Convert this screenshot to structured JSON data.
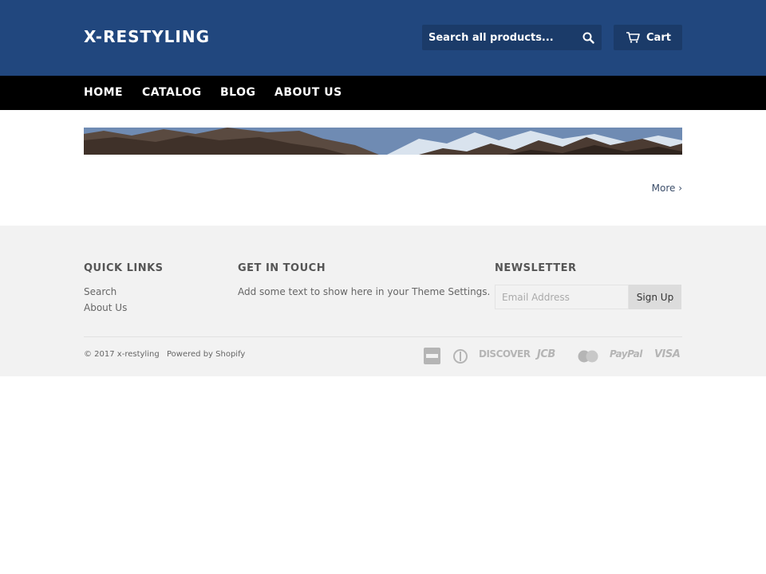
{
  "header": {
    "logo": "X-RESTYLING",
    "search": {
      "placeholder": "Search all products..."
    },
    "cart_label": "Cart"
  },
  "nav": {
    "items": [
      {
        "label": "HOME"
      },
      {
        "label": "CATALOG"
      },
      {
        "label": "BLOG"
      },
      {
        "label": "ABOUT US"
      }
    ]
  },
  "main": {
    "more_link": "More ›"
  },
  "footer": {
    "quick_links": {
      "heading": "QUICK LINKS",
      "items": [
        "Search",
        "About Us"
      ]
    },
    "get_in_touch": {
      "heading": "GET IN TOUCH",
      "text": "Add some text to show here in your Theme Settings."
    },
    "newsletter": {
      "heading": "NEWSLETTER",
      "email_placeholder": "Email Address",
      "button_label": "Sign Up"
    },
    "copyright": "© 2017 x-restyling",
    "powered_by": "Powered by Shopify",
    "payment_icons": [
      "american-express-icon",
      "diners-club-icon",
      "discover-icon",
      "jcb-icon",
      "master-icon",
      "paypal-icon",
      "visa-icon"
    ],
    "payment_labels": {
      "discover": "DISCOVER",
      "jcb": "JCB",
      "paypal": "PayPal",
      "visa": "VISA"
    }
  },
  "colors": {
    "header_bg": "#21477e",
    "header_control_bg": "#1b3b69",
    "nav_bg": "#000000",
    "footer_bg": "#f2f2f2"
  }
}
